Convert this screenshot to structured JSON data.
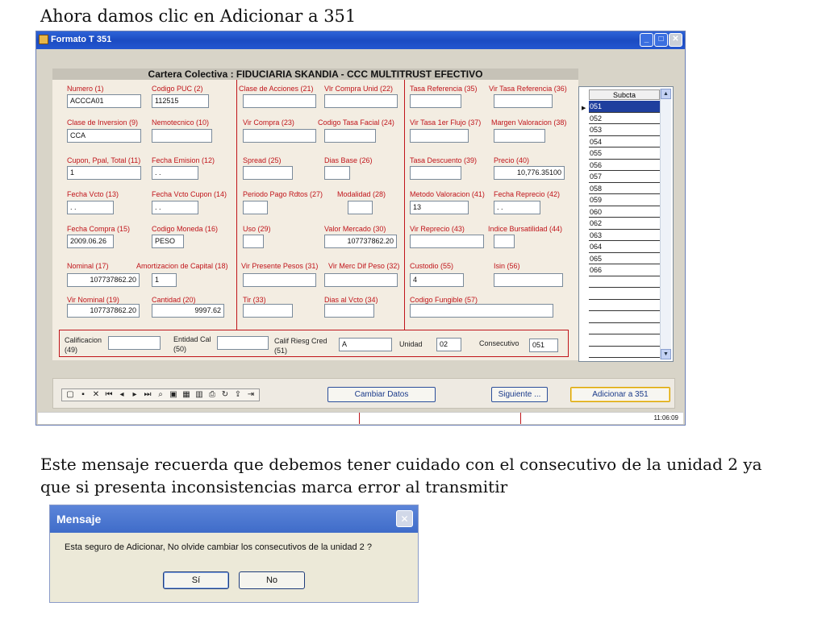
{
  "captions": {
    "top": "Ahora damos clic en Adicionar a 351",
    "middle": "Este mensaje recuerda que debemos tener cuidado con el consecutivo de la unidad 2 ya que si presenta inconsistencias marca error al transmitir"
  },
  "window": {
    "title": "Formato T 351",
    "icon": "app-icon",
    "controls": [
      "minimize-icon",
      "maximize-icon",
      "close-icon"
    ]
  },
  "form": {
    "header": "Cartera Colectiva : FIDUCIARIA SKANDIA - CCC MULTITRUST EFECTIVO",
    "numero": {
      "label": "Numero  (1)",
      "value": "ACCCA01"
    },
    "codigo_puc": {
      "label": "Codigo PUC (2)",
      "value": "112515"
    },
    "clase_acciones": {
      "label": "Clase de Acciones (21)",
      "value": ""
    },
    "vlr_compra_unid": {
      "label": "Vlr Compra Unid (22)",
      "value": ""
    },
    "tasa_referencia": {
      "label": "Tasa Referencia (35)",
      "value": ""
    },
    "vir_tasa_referencia": {
      "label": "Vir Tasa Referencia (36)",
      "value": ""
    },
    "clase_inversion": {
      "label": "Clase de Inversion (9)",
      "value": "CCA"
    },
    "nemotecnico": {
      "label": "Nemotecnico (10)",
      "value": ""
    },
    "vir_compra": {
      "label": "Vir Compra (23)",
      "value": ""
    },
    "codigo_tasa_facial": {
      "label": "Codigo Tasa Facial (24)",
      "value": ""
    },
    "vir_tasa_1er_flujo": {
      "label": "Vir Tasa 1er Flujo (37)",
      "value": ""
    },
    "margen_valoracion": {
      "label": "Margen Valoracion (38)",
      "value": ""
    },
    "cupon": {
      "label": "Cupon, Ppal, Total (11)",
      "value": "1"
    },
    "fecha_emision": {
      "label": "Fecha Emision (12)",
      "value": ".  ."
    },
    "spread": {
      "label": "Spread (25)",
      "value": ""
    },
    "dias_base": {
      "label": "Dias Base (26)",
      "value": ""
    },
    "tasa_descuento": {
      "label": "Tasa Descuento (39)",
      "value": ""
    },
    "precio": {
      "label": "Precio (40)",
      "value": "10,776.35100"
    },
    "fecha_vcto": {
      "label": "Fecha Vcto (13)",
      "value": ".  ."
    },
    "fecha_vcto_cupon": {
      "label": "Fecha Vcto Cupon (14)",
      "value": ".  ."
    },
    "periodo_pago": {
      "label": "Periodo Pago Rdtos (27)",
      "value": ""
    },
    "modalidad": {
      "label": "Modalidad (28)",
      "value": ""
    },
    "metodo_valoracion": {
      "label": "Metodo Valoracion (41)",
      "value": "13"
    },
    "fecha_reprecio": {
      "label": "Fecha Reprecio (42)",
      "value": ".  ."
    },
    "fecha_compra": {
      "label": "Fecha Compra (15)",
      "value": "2009.06.26"
    },
    "codigo_moneda": {
      "label": "Codigo Moneda  (16)",
      "value": "PESO"
    },
    "uso": {
      "label": "Uso  (29)",
      "value": ""
    },
    "valor_mercado": {
      "label": "Valor Mercado (30)",
      "value": "107737862.20"
    },
    "vir_reprecio": {
      "label": "Vir Reprecio (43)",
      "value": ""
    },
    "indice_bursatilidad": {
      "label": "Indice Bursatilidad (44)",
      "value": ""
    },
    "nominal": {
      "label": "Nominal (17)",
      "value": "107737862.20"
    },
    "amortizacion": {
      "label": "Amortizacion de Capital (18)",
      "value": "1"
    },
    "vir_presente_pesos": {
      "label": "Vir Presente Pesos (31)",
      "value": ""
    },
    "vir_merc_dif_peso": {
      "label": "Vir Merc Dif Peso (32)",
      "value": ""
    },
    "custodio": {
      "label": "Custodio (55)",
      "value": "4"
    },
    "isin": {
      "label": "Isin (56)",
      "value": ""
    },
    "vir_nominal": {
      "label": "Vir Nominal (19)",
      "value": "107737862.20"
    },
    "cantidad": {
      "label": "Cantidad (20)",
      "value": "9997.62"
    },
    "tir": {
      "label": "Tir (33)",
      "value": ""
    },
    "dias_al_vcto": {
      "label": "Dias al Vcto (34)",
      "value": ""
    },
    "codigo_fungible": {
      "label": "Codigo Fungible (57)",
      "value": ""
    },
    "calificacion": {
      "label1": "Calificacion",
      "label2": "(49)",
      "value": ""
    },
    "entidad_cal": {
      "label1": "Entidad Cal",
      "label2": "(50)",
      "value": ""
    },
    "calif_riesg_cred": {
      "label1": "Calif Riesg Cred",
      "label2": "(51)",
      "value": "A"
    },
    "unidad": {
      "label": "Unidad",
      "value": "02"
    },
    "consecutivo": {
      "label": "Consecutivo",
      "value": "051"
    }
  },
  "subcta": {
    "header": "Subcta",
    "rows": [
      "051",
      "052",
      "053",
      "054",
      "055",
      "056",
      "057",
      "058",
      "059",
      "060",
      "062",
      "063",
      "064",
      "065",
      "066"
    ],
    "selected_index": 0
  },
  "toolbar": {
    "icons": [
      "new-icon",
      "save-icon",
      "delete-icon",
      "first-icon",
      "prev-icon",
      "next-icon",
      "last-icon",
      "find-icon",
      "browse-icon",
      "grid-icon",
      "chart-icon",
      "print-icon",
      "refresh-icon",
      "export-icon",
      "exit-icon"
    ],
    "cambiar_datos": "Cambiar Datos",
    "siguiente": "Siguiente ...",
    "adicionar": "Adicionar a 351"
  },
  "status": {
    "clock": "11:06:09"
  },
  "dialog": {
    "title": "Mensaje",
    "message": "Esta seguro de Adicionar, No olvide cambiar los consecutivos de la unidad 2 ?",
    "yes": "Sí",
    "no": "No"
  }
}
